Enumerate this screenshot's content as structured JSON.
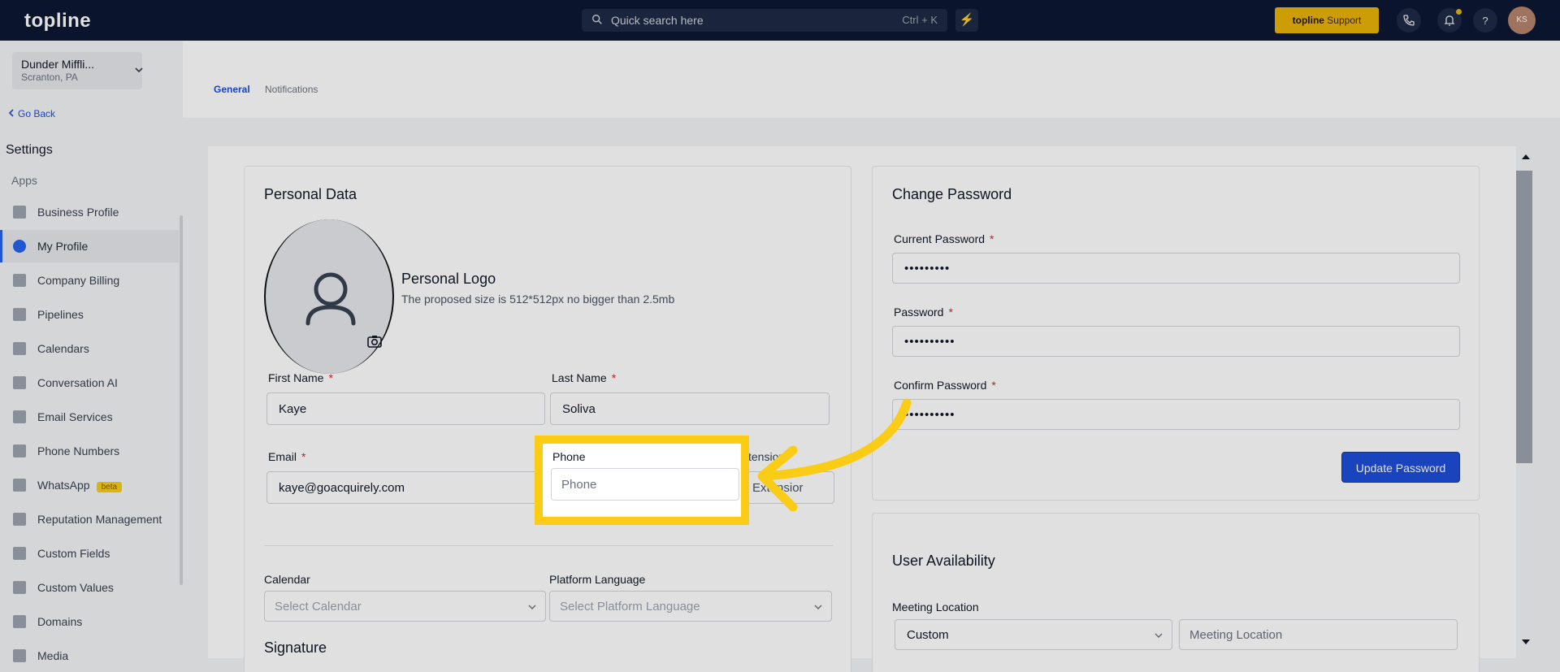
{
  "topbar": {
    "logo": "topline",
    "search_placeholder": "Quick search here",
    "search_shortcut": "Ctrl + K",
    "support_brand": "topline",
    "support_label": " Support",
    "avatar_initials": "KS"
  },
  "sidebar": {
    "location_name": "Dunder Miffli...",
    "location_city": "Scranton, PA",
    "go_back": "Go Back",
    "settings_title": "Settings",
    "apps_label": "Apps",
    "items": [
      {
        "label": "Business Profile"
      },
      {
        "label": "My Profile"
      },
      {
        "label": "Company Billing"
      },
      {
        "label": "Pipelines"
      },
      {
        "label": "Calendars"
      },
      {
        "label": "Conversation AI"
      },
      {
        "label": "Email Services"
      },
      {
        "label": "Phone Numbers"
      },
      {
        "label": "WhatsApp",
        "badge": "beta"
      },
      {
        "label": "Reputation Management"
      },
      {
        "label": "Custom Fields"
      },
      {
        "label": "Custom Values"
      },
      {
        "label": "Domains"
      },
      {
        "label": "Media"
      }
    ]
  },
  "tabs": [
    "General",
    "Notifications"
  ],
  "personal": {
    "title": "Personal Data",
    "logo_title": "Personal Logo",
    "logo_hint": "The proposed size is 512*512px no bigger than 2.5mb",
    "first_name_label": "First Name",
    "first_name_value": "Kaye",
    "last_name_label": "Last Name",
    "last_name_value": "Soliva",
    "email_label": "Email",
    "email_value": "kaye@goacquirely.com",
    "phone_label": "Phone",
    "phone_placeholder": "Phone",
    "extension_label_partial": "xtension",
    "extension_placeholder_partial": "Extensior",
    "calendar_label": "Calendar",
    "calendar_placeholder": "Select Calendar",
    "language_label": "Platform Language",
    "language_placeholder": "Select Platform Language",
    "signature_label": "Signature",
    "required_mark": "*"
  },
  "password": {
    "title": "Change Password",
    "current_label": "Current Password",
    "current_value": "•••••••••",
    "password_label": "Password",
    "password_value": "••••••••••",
    "confirm_label": "Confirm Password",
    "confirm_value": "••••••••••",
    "button": "Update Password"
  },
  "availability": {
    "title": "User Availability",
    "meeting_location_label": "Meeting Location",
    "meeting_type_value": "Custom",
    "meeting_location_placeholder": "Meeting Location"
  },
  "colors": {
    "topbar": "#0c1733",
    "accent": "#1d4ed8",
    "highlight": "#facc15"
  }
}
